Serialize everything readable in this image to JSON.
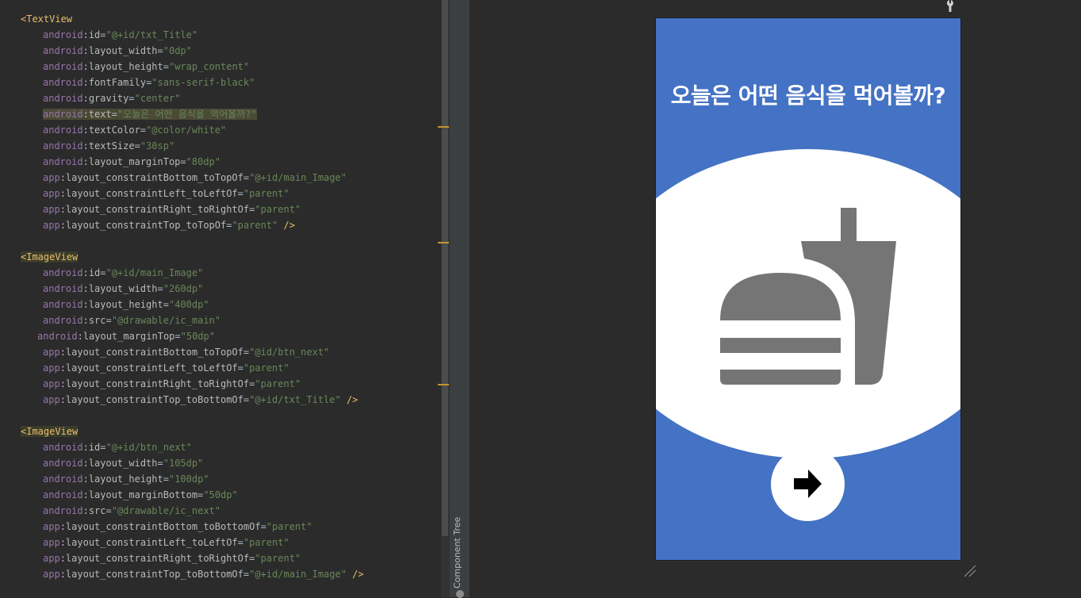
{
  "code": {
    "lines": [
      {
        "tag": "<TextView"
      },
      {
        "ns": "android",
        "attr": "id",
        "val": "\"@+id/txt_Title\""
      },
      {
        "ns": "android",
        "attr": "layout_width",
        "val": "\"0dp\""
      },
      {
        "ns": "android",
        "attr": "layout_height",
        "val": "\"wrap_content\""
      },
      {
        "ns": "android",
        "attr": "fontFamily",
        "val": "\"sans-serif-black\""
      },
      {
        "ns": "android",
        "attr": "gravity",
        "val": "\"center\""
      },
      {
        "ns": "android",
        "attr": "text",
        "val": "\"오늘은 어떤 음식을 먹어볼까?\"",
        "highlight": true
      },
      {
        "ns": "android",
        "attr": "textColor",
        "val": "\"@color/white\""
      },
      {
        "ns": "android",
        "attr": "textSize",
        "val": "\"30sp\""
      },
      {
        "ns": "android",
        "attr": "layout_marginTop",
        "val": "\"80dp\""
      },
      {
        "ns": "app",
        "attr": "layout_constraintBottom_toTopOf",
        "val": "\"@+id/main_Image\""
      },
      {
        "ns": "app",
        "attr": "layout_constraintLeft_toLeftOf",
        "val": "\"parent\""
      },
      {
        "ns": "app",
        "attr": "layout_constraintRight_toRightOf",
        "val": "\"parent\""
      },
      {
        "ns": "app",
        "attr": "layout_constraintTop_toTopOf",
        "val": "\"parent\"",
        "close": " />"
      },
      {
        "blank": true
      },
      {
        "tag": "<ImageView",
        "taghl": true
      },
      {
        "ns": "android",
        "attr": "id",
        "val": "\"@+id/main_Image\""
      },
      {
        "ns": "android",
        "attr": "layout_width",
        "val": "\"260dp\""
      },
      {
        "ns": "android",
        "attr": "layout_height",
        "val": "\"400dp\""
      },
      {
        "ns": "android",
        "attr": "src",
        "val": "\"@drawable/ic_main\""
      },
      {
        "ns": "android",
        "attr": "layout_marginTop",
        "val": "\"50dp\"",
        "shift": true
      },
      {
        "ns": "app",
        "attr": "layout_constraintBottom_toTopOf",
        "val": "\"@id/btn_next\""
      },
      {
        "ns": "app",
        "attr": "layout_constraintLeft_toLeftOf",
        "val": "\"parent\""
      },
      {
        "ns": "app",
        "attr": "layout_constraintRight_toRightOf",
        "val": "\"parent\""
      },
      {
        "ns": "app",
        "attr": "layout_constraintTop_toBottomOf",
        "val": "\"@+id/txt_Title\"",
        "close": " />"
      },
      {
        "blank": true
      },
      {
        "tag": "<ImageView",
        "taghl": true
      },
      {
        "ns": "android",
        "attr": "id",
        "val": "\"@+id/btn_next\""
      },
      {
        "ns": "android",
        "attr": "layout_width",
        "val": "\"105dp\""
      },
      {
        "ns": "android",
        "attr": "layout_height",
        "val": "\"100dp\""
      },
      {
        "ns": "android",
        "attr": "layout_marginBottom",
        "val": "\"50dp\""
      },
      {
        "ns": "android",
        "attr": "src",
        "val": "\"@drawable/ic_next\""
      },
      {
        "ns": "app",
        "attr": "layout_constraintBottom_toBottomOf",
        "val": "\"parent\""
      },
      {
        "ns": "app",
        "attr": "layout_constraintLeft_toLeftOf",
        "val": "\"parent\""
      },
      {
        "ns": "app",
        "attr": "layout_constraintRight_toRightOf",
        "val": "\"parent\""
      },
      {
        "ns": "app",
        "attr": "layout_constraintTop_toBottomOf",
        "val": "\"@+id/main_Image\"",
        "close": " />"
      }
    ]
  },
  "side_panel": {
    "label": "Component Tree"
  },
  "preview": {
    "title": "오늘은 어떤 음식을 먹어볼까?",
    "background_color": "#4472c4",
    "image_icon": "fastfood-icon",
    "button_icon": "arrow-right-icon"
  },
  "toolbar": {
    "icon": "wrench-icon"
  },
  "resize_icon": "resize-handle-icon"
}
